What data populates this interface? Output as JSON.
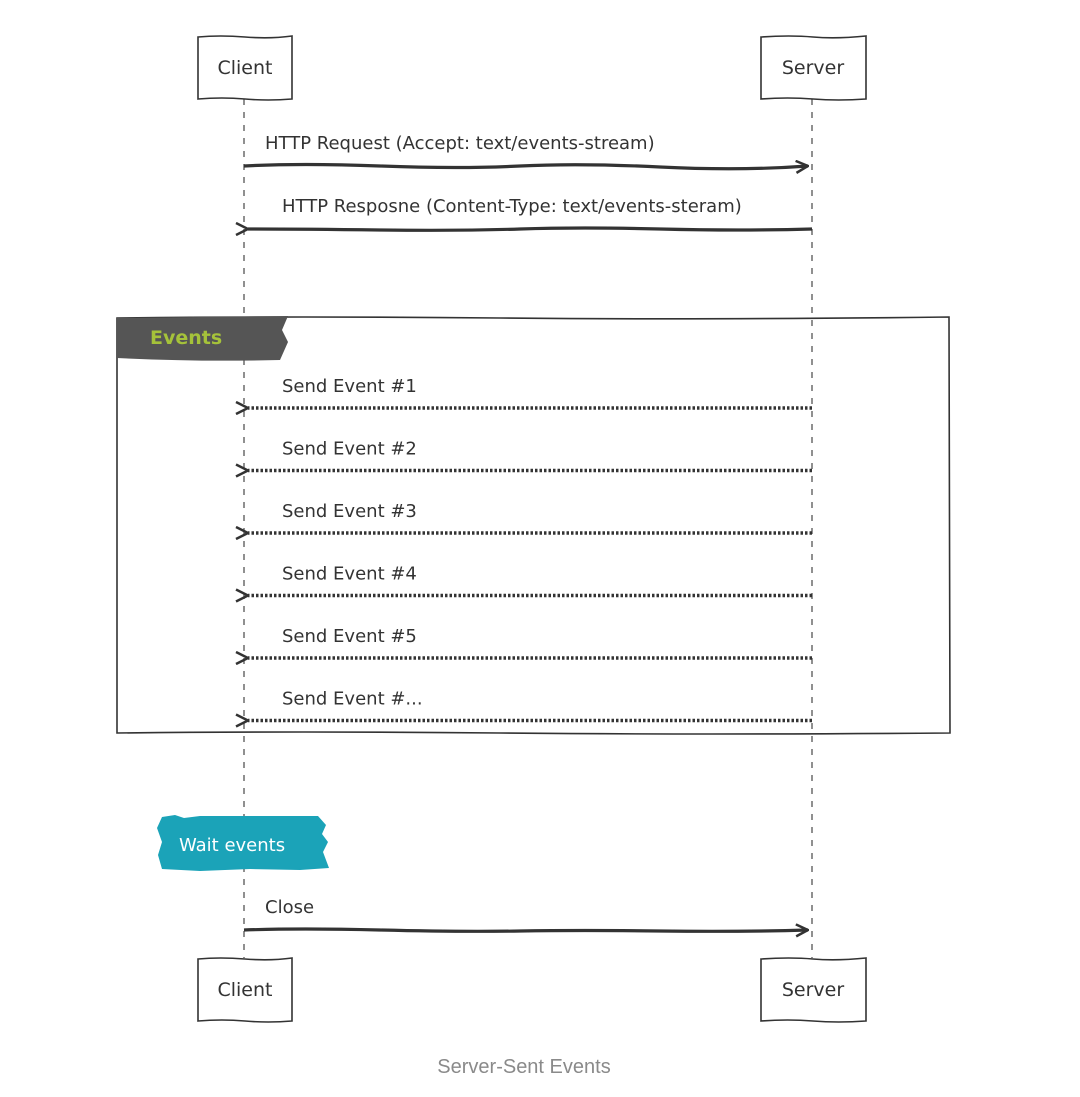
{
  "actors": {
    "client": "Client",
    "server": "Server"
  },
  "messages": {
    "request": "HTTP Request (Accept: text/events-stream)",
    "response": "HTTP Resposne (Content-Type: text/events-steram)",
    "close": "Close"
  },
  "group": {
    "label": "Events",
    "events": [
      "Send Event #1",
      "Send Event #2",
      "Send Event #3",
      "Send Event #4",
      "Send Event #5",
      "Send Event #..."
    ]
  },
  "note": {
    "label": "Wait events"
  },
  "caption": "Server-Sent Events",
  "colors": {
    "line": "#333333",
    "group_tab": "#555555",
    "group_label": "#a5c23a",
    "note_fill": "#1ba3b8",
    "caption": "#8a8a8a"
  }
}
